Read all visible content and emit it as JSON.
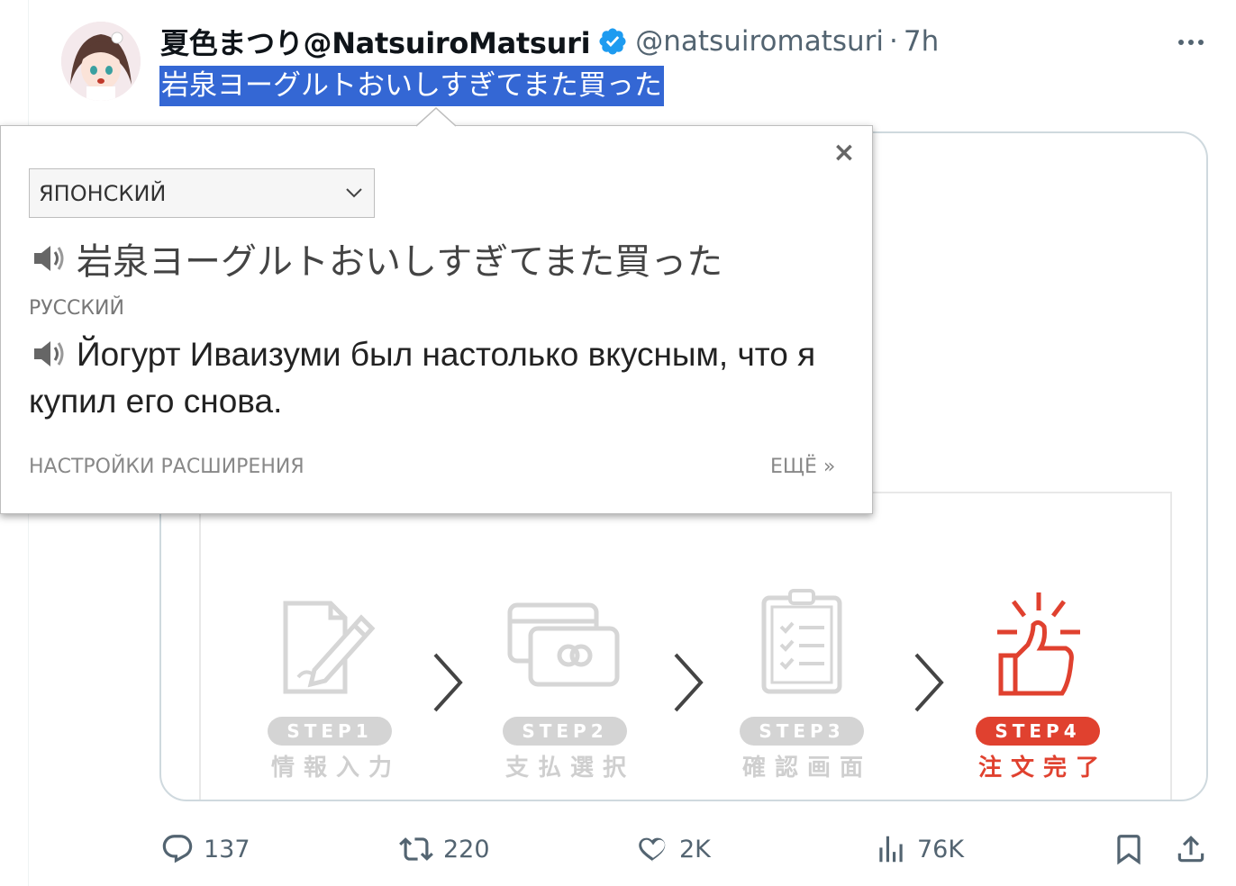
{
  "tweet": {
    "display_name": "夏色まつり@NatsuiroMatsuri",
    "handle": "@natsuiromatsuri",
    "separator": "·",
    "time": "7h",
    "text": "岩泉ヨーグルトおいしすぎてまた買った"
  },
  "translator": {
    "close_symbol": "×",
    "source_language": "ЯПОНСКИЙ",
    "source_text": "岩泉ヨーグルトおいしすぎてまた買った",
    "target_language": "РУССКИЙ",
    "translation": "Йогурт Иваизуми был настолько вкусным, что я купил его снова.",
    "settings_link": "НАСТРОЙКИ РАСШИРЕНИЯ",
    "more_link": "ЕЩЁ »"
  },
  "media": {
    "steps": [
      {
        "label": "STEP1",
        "caption": "情報入力",
        "active": false
      },
      {
        "label": "STEP2",
        "caption": "支払選択",
        "active": false
      },
      {
        "label": "STEP3",
        "caption": "確認画面",
        "active": false
      },
      {
        "label": "STEP4",
        "caption": "注文完了",
        "active": true
      }
    ],
    "inactive_color": "#d4d4d4",
    "active_color": "#e0412f"
  },
  "actions": {
    "replies": "137",
    "retweets": "220",
    "likes": "2K",
    "views": "76K"
  },
  "colors": {
    "selection": "#3467d4",
    "verified": "#1d9bf0",
    "secondary_text": "#536471"
  }
}
